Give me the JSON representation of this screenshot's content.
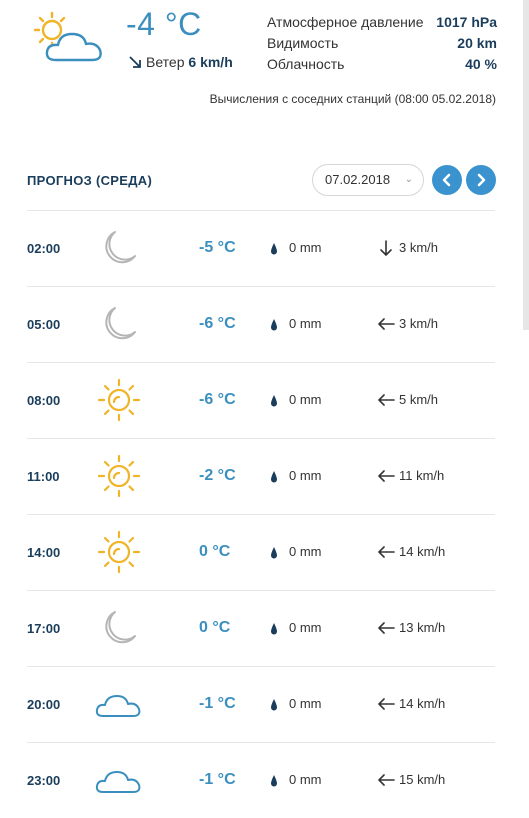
{
  "current": {
    "icon": "partly-cloudy-icon",
    "temperature": "-4 °C",
    "wind_label": "Ветер",
    "wind_value": "6 km/h",
    "stats": [
      {
        "label": "Атмосферное давление",
        "value": "1017 hPa"
      },
      {
        "label": "Видимость",
        "value": "20 km"
      },
      {
        "label": "Облачность",
        "value": "40 %"
      }
    ],
    "note": "Вычисления с соседних станций (08:00 05.02.2018)"
  },
  "forecast": {
    "title": "ПРОГНОЗ (СРЕДА)",
    "date": "07.02.2018",
    "rows": [
      {
        "time": "02:00",
        "icon": "moon-icon",
        "temp": "-5 °C",
        "precip": "0 mm",
        "wind_dir": "down-arrow-icon",
        "wind": "3 km/h"
      },
      {
        "time": "05:00",
        "icon": "moon-icon",
        "temp": "-6 °C",
        "precip": "0 mm",
        "wind_dir": "left-arrow-icon",
        "wind": "3 km/h"
      },
      {
        "time": "08:00",
        "icon": "sun-icon",
        "temp": "-6 °C",
        "precip": "0 mm",
        "wind_dir": "left-arrow-icon",
        "wind": "5 km/h"
      },
      {
        "time": "11:00",
        "icon": "sun-icon",
        "temp": "-2 °C",
        "precip": "0 mm",
        "wind_dir": "left-arrow-icon",
        "wind": "11 km/h"
      },
      {
        "time": "14:00",
        "icon": "sun-icon",
        "temp": "0 °C",
        "precip": "0 mm",
        "wind_dir": "left-arrow-icon",
        "wind": "14 km/h"
      },
      {
        "time": "17:00",
        "icon": "moon-icon",
        "temp": "0 °C",
        "precip": "0 mm",
        "wind_dir": "left-arrow-icon",
        "wind": "13 km/h"
      },
      {
        "time": "20:00",
        "icon": "cloud-icon",
        "temp": "-1 °C",
        "precip": "0 mm",
        "wind_dir": "left-arrow-icon",
        "wind": "14 km/h"
      },
      {
        "time": "23:00",
        "icon": "cloud-icon",
        "temp": "-1 °C",
        "precip": "0 mm",
        "wind_dir": "left-arrow-icon",
        "wind": "15 km/h"
      }
    ]
  },
  "colors": {
    "accent": "#3a93cf",
    "temp": "#3b8fbf",
    "dark": "#1a3d5c",
    "sun": "#f0b429",
    "moon": "#b5b5b5",
    "cloud": "#3b8fbf"
  }
}
